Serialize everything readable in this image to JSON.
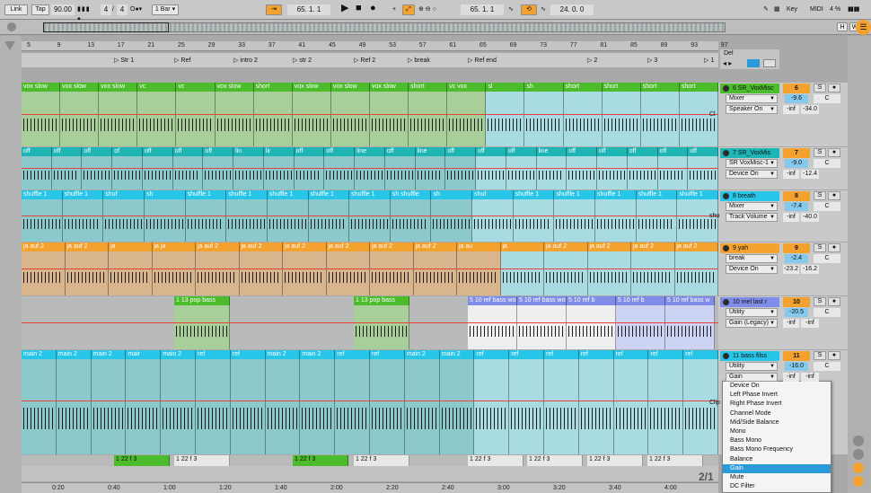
{
  "transport": {
    "link": "Link",
    "tap": "Tap",
    "tempo": "90.00",
    "meter_num": "4",
    "meter_den": "4",
    "quant": "1 Bar",
    "pos": "65.   1.   1",
    "loop_start": "65.   1.   1",
    "loop_len": "24.   0.   0",
    "key": "Key",
    "midi": "MIDI",
    "cpu": "4 %",
    "h": "H",
    "w": "W",
    "d": "D"
  },
  "locators": [
    "Str 1",
    "Ref",
    "intro 2",
    "str 2",
    "Ref 2",
    "break",
    "Ref end",
    "2",
    "3",
    "1"
  ],
  "ruler": [
    "5",
    "9",
    "13",
    "17",
    "21",
    "25",
    "29",
    "33",
    "37",
    "41",
    "45",
    "49",
    "53",
    "57",
    "61",
    "65",
    "69",
    "73",
    "77",
    "81",
    "85",
    "89",
    "93",
    "97"
  ],
  "time": [
    "0:20",
    "0:40",
    "1:00",
    "1:20",
    "1:40",
    "2:00",
    "2:20",
    "2:40",
    "3:00",
    "3:20",
    "3:40",
    "4:00"
  ],
  "page_indicator": "2/1",
  "del_label": "Del",
  "tracks": [
    {
      "name": "6 SR_VoxMisc",
      "num": "6",
      "dev1": "Mixer",
      "dev2": "Speaker On",
      "vol": "-9.6",
      "pan": "C",
      "v1": "-inf",
      "v2": "-34.0",
      "color": "#4cbb2c",
      "clip_label": "Cl",
      "clips": [
        "vox slow",
        "vox slow",
        "vox slow",
        "vc",
        "vc",
        "vox slow",
        "short",
        "vox slow",
        "vox slow",
        "vox slow",
        "short",
        "vc vox",
        "sl",
        "sh",
        "short",
        "short",
        "short",
        "short"
      ]
    },
    {
      "name": "7 SR_VoxMis",
      "num": "7",
      "dev1": "SR VoxMisc-1",
      "dev2": "Device On",
      "vol": "-9.0",
      "pan": "C",
      "v1": "-inf",
      "v2": "-12.4",
      "color": "#1fb5b5",
      "clip_label": "",
      "clips": [
        "off",
        "off",
        "off",
        "of",
        "off",
        "off",
        "off",
        "lin",
        "lir",
        "off",
        "off",
        "line",
        "off",
        "line",
        "off",
        "off",
        "off",
        "line",
        "off",
        "off",
        "off",
        "off",
        "off"
      ]
    },
    {
      "name": "8 breath",
      "num": "8",
      "dev1": "Mixer",
      "dev2": "Track Volume",
      "vol": "-7.4",
      "pan": "C",
      "v1": "-inf",
      "v2": "-40.0",
      "color": "#27c6e8",
      "clip_label": "shu",
      "clips": [
        "shuffle 1",
        "shuffle 1",
        "shuf",
        "sh",
        "shuffle 1",
        "shuffle 1",
        "shuffle 1",
        "shuffle 1",
        "shuffle 1",
        "sh shuffle",
        "sh",
        "shuf",
        "shuffle 1",
        "shuffle 1",
        "shuffle 1",
        "shuffle 1",
        "shuffle 1"
      ]
    },
    {
      "name": "9 yah",
      "num": "9",
      "dev1": "break",
      "dev2": "Device On",
      "vol": "-2.4",
      "pan": "C",
      "v1": "-23.2",
      "v2": "-16.2",
      "color": "#f3a12f",
      "clip_label": "",
      "clips": [
        "ja auf 2",
        "ja auf 2",
        "ja",
        "ja ja",
        "ja auf 2",
        "ja auf 2",
        "ja auf 2",
        "ja auf 2",
        "ja auf 2",
        "ja auf 2",
        "ja au",
        "ja",
        "ja auf 2",
        "ja auf 2",
        "ja auf 2",
        "ja auf 2"
      ]
    },
    {
      "name": "10 mel  last r",
      "num": "10",
      "dev1": "Utility",
      "dev2": "Gain (Legacy)",
      "vol": "-20.5",
      "pan": "C",
      "v1": "-inf",
      "v2": "-inf",
      "color": "#7f8de8",
      "clip_label": "",
      "clips": [
        "1 13 pop bass",
        "1 13 pop bass",
        "5 10 ref bass wobb",
        "5 10 ref bass wobbl",
        "5 10 ref b",
        "5 10 ref b",
        "5 10 ref bass w"
      ]
    },
    {
      "name": "11 bass filss",
      "num": "11",
      "dev1": "Utility",
      "dev2": "Gain",
      "vol": "-16.0",
      "pan": "C",
      "v1": "-inf",
      "v2": "-inf",
      "color": "#27c6e8",
      "clip_label": "Clip",
      "clips": [
        "main 2",
        "main 2",
        "main 2",
        "mair",
        "main 2",
        "ref",
        "ref",
        "main 2",
        "main 2",
        "ref",
        "ref",
        "main 2",
        "main 2",
        "ref",
        "ref",
        "ref",
        "ref",
        "ref",
        "ref",
        "ref"
      ]
    }
  ],
  "bottom_clips": [
    "1 22 f 3",
    "1 22 f 3",
    "1 22 f 3",
    "1 22 f 3",
    "1 22 f 3",
    "1 22 f 3",
    "1 22 f 3",
    "1 22 f 3"
  ],
  "menu": [
    "Device On",
    "Left Phase Invert",
    "Right Phase Invert",
    "Channel Mode",
    "Mid/Side Balance",
    "Mono",
    "Bass Mono",
    "Bass Mono Frequency",
    "Balance",
    "Gain",
    "Mute",
    "DC Filter"
  ],
  "menu_selected": "Gain",
  "colors": {
    "green": "#4cbb2c",
    "teal": "#1fb5b5",
    "cyan": "#27c6e8",
    "orange": "#f3a12f",
    "purple": "#7f8de8",
    "automation": "#e8423b",
    "selected": "#2a9bd8"
  }
}
